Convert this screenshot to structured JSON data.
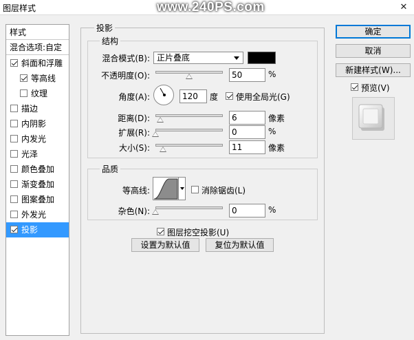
{
  "window": {
    "title": "图层样式",
    "watermark": "www.240PS.com",
    "close_glyph": "✕"
  },
  "left_panel": {
    "header_styles": "样式",
    "header_blend": "混合选项:自定",
    "items": [
      {
        "label": "斜面和浮雕",
        "checked": true
      },
      {
        "label": "等高线",
        "checked": true
      },
      {
        "label": "纹理",
        "checked": false
      },
      {
        "label": "描边",
        "checked": false
      },
      {
        "label": "内阴影",
        "checked": false
      },
      {
        "label": "内发光",
        "checked": false
      },
      {
        "label": "光泽",
        "checked": false
      },
      {
        "label": "颜色叠加",
        "checked": false
      },
      {
        "label": "渐变叠加",
        "checked": false
      },
      {
        "label": "图案叠加",
        "checked": false
      },
      {
        "label": "外发光",
        "checked": false
      },
      {
        "label": "投影",
        "checked": true,
        "selected": true
      }
    ]
  },
  "section": {
    "title": "投影"
  },
  "structure": {
    "title": "结构",
    "blend_mode_label": "混合模式(B):",
    "blend_mode_value": "正片叠底",
    "shadow_color": "#000000",
    "opacity_label": "不透明度(O):",
    "opacity_value": "50",
    "opacity_unit": "%",
    "angle_label": "角度(A):",
    "angle_value": "120",
    "angle_unit": "度",
    "global_light_label": "使用全局光(G)",
    "global_light_checked": true,
    "distance_label": "距离(D):",
    "distance_value": "6",
    "distance_unit": "像素",
    "spread_label": "扩展(R):",
    "spread_value": "0",
    "spread_unit": "%",
    "size_label": "大小(S):",
    "size_value": "11",
    "size_unit": "像素"
  },
  "quality": {
    "title": "品质",
    "contour_label": "等高线:",
    "antialias_label": "消除锯齿(L)",
    "antialias_checked": false,
    "noise_label": "杂色(N):",
    "noise_value": "0",
    "noise_unit": "%"
  },
  "bottom": {
    "knockout_label": "图层挖空投影(U)",
    "knockout_checked": true,
    "make_default_label": "设置为默认值",
    "reset_default_label": "复位为默认值"
  },
  "right_panel": {
    "ok_label": "确定",
    "cancel_label": "取消",
    "new_style_label": "新建样式(W)...",
    "preview_label": "预览(V)",
    "preview_checked": true
  }
}
